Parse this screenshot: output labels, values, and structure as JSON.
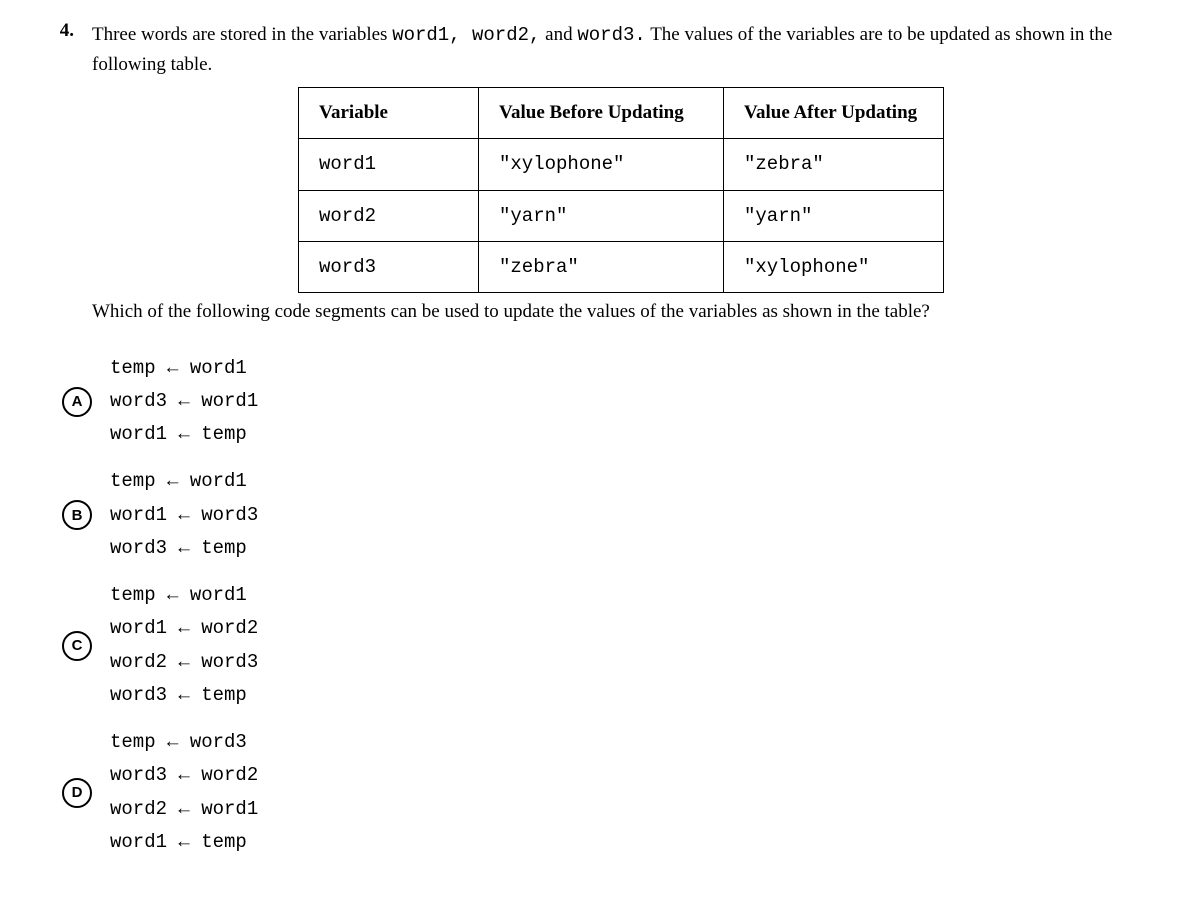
{
  "question": {
    "number": "4.",
    "text_part1": "Three words are stored in the variables ",
    "code1": "word1, word2,",
    "text_part2": " and ",
    "code2": "word3.",
    "text_part3": " The values of the variables are to be updated as shown in the following table.",
    "followup": "Which of the following code segments can be used to update the values of the variables as shown in the table?"
  },
  "table": {
    "headers": {
      "variable": "Variable",
      "before": "Value Before Updating",
      "after": "Value After Updating"
    },
    "rows": [
      {
        "variable": "word1",
        "before": "\"xylophone\"",
        "after": "\"zebra\""
      },
      {
        "variable": "word2",
        "before": "\"yarn\"",
        "after": "\"yarn\""
      },
      {
        "variable": "word3",
        "before": "\"zebra\"",
        "after": "\"xylophone\""
      }
    ]
  },
  "choices": [
    {
      "letter": "A",
      "lines": [
        "temp ← word1",
        "word3 ← word1",
        "word1 ← temp"
      ]
    },
    {
      "letter": "B",
      "lines": [
        "temp ← word1",
        "word1 ← word3",
        "word3 ← temp"
      ]
    },
    {
      "letter": "C",
      "lines": [
        "temp ← word1",
        "word1 ← word2",
        "word2 ← word3",
        "word3 ← temp"
      ]
    },
    {
      "letter": "D",
      "lines": [
        "temp ← word3",
        "word3 ← word2",
        "word2 ← word1",
        "word1 ← temp"
      ]
    }
  ]
}
